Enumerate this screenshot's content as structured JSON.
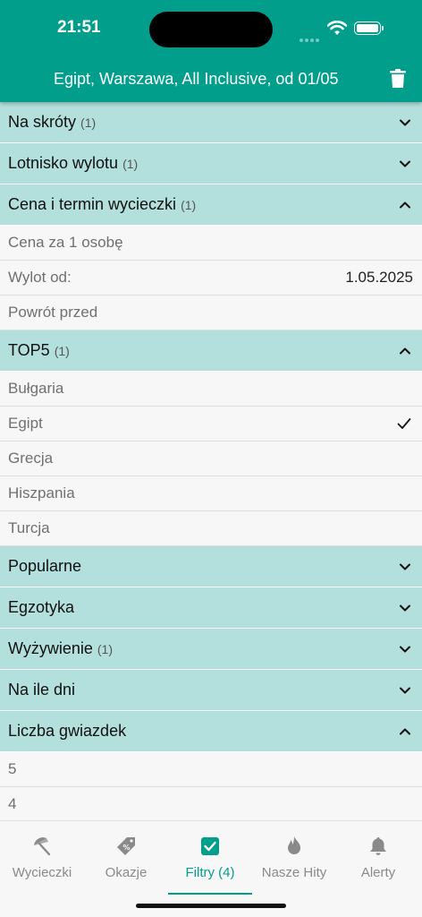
{
  "status": {
    "time": "21:51"
  },
  "header": {
    "title": "Egipt, Warszawa, All Inclusive, od 01/05"
  },
  "sections": {
    "na_skroty": {
      "label": "Na skróty",
      "count": "(1)"
    },
    "lotnisko": {
      "label": "Lotnisko wylotu",
      "count": "(1)"
    },
    "cena": {
      "label": "Cena i termin wycieczki",
      "count": "(1)",
      "rows": [
        {
          "label": "Cena za 1 osobę",
          "value": ""
        },
        {
          "label": "Wylot od:",
          "value": "1.05.2025"
        },
        {
          "label": "Powrót przed",
          "value": ""
        }
      ]
    },
    "top5": {
      "label": "TOP5",
      "count": "(1)",
      "rows": [
        {
          "label": "Bułgaria"
        },
        {
          "label": "Egipt",
          "checked": true
        },
        {
          "label": "Grecja"
        },
        {
          "label": "Hiszpania"
        },
        {
          "label": "Turcja"
        }
      ]
    },
    "popularne": {
      "label": "Popularne"
    },
    "egzotyka": {
      "label": "Egzotyka"
    },
    "wyzywienie": {
      "label": "Wyżywienie",
      "count": "(1)"
    },
    "na_ile_dni": {
      "label": "Na ile dni"
    },
    "gwiazdki": {
      "label": "Liczba gwiazdek",
      "rows": [
        {
          "label": "5"
        },
        {
          "label": "4"
        }
      ]
    }
  },
  "tabs": [
    {
      "label": "Wycieczki",
      "icon": "beach-umbrella-icon"
    },
    {
      "label": "Okazje",
      "icon": "price-tag-icon"
    },
    {
      "label": "Filtry (4)",
      "icon": "checkbox-icon",
      "active": true
    },
    {
      "label": "Nasze Hity",
      "icon": "flame-icon"
    },
    {
      "label": "Alerty",
      "icon": "bell-icon"
    }
  ],
  "colors": {
    "accent": "#009e8b",
    "section_bg": "#b3e0dc",
    "background": "#f7f7f7"
  }
}
